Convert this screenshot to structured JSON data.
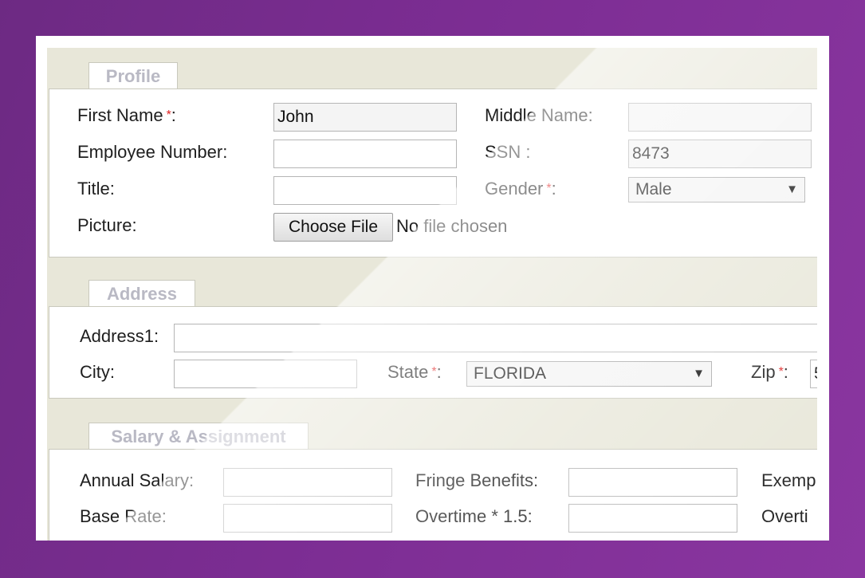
{
  "profile": {
    "tab": "Profile",
    "first_name_label": "First Name",
    "first_name_value": "John",
    "middle_name_label": "Middle Name:",
    "middle_name_value": "",
    "employee_number_label": "Employee Number:",
    "employee_number_value": "",
    "ssn_label": "SSN :",
    "ssn_value": "8473",
    "title_label": "Title:",
    "title_value": "",
    "gender_label": "Gender",
    "gender_value": "Male",
    "picture_label": "Picture:",
    "choose_file": "Choose File",
    "no_file": "No file chosen",
    "required_mark": "*",
    "colon": ":"
  },
  "address": {
    "tab": "Address",
    "address1_label": "Address1:",
    "address1_value": "",
    "city_label": "City:",
    "city_value": "",
    "state_label": "State",
    "state_value": "FLORIDA",
    "zip_label": "Zip",
    "zip_value": "5"
  },
  "salary": {
    "tab": "Salary & Assignment",
    "annual_salary_label": "Annual Salary:",
    "fringe_label": "Fringe Benefits:",
    "exempt_label": "Exemp",
    "base_rate_label": "Base Rate:",
    "overtime_label": "Overtime * 1.5:",
    "overtime2_label": "Overti"
  },
  "icons": {
    "dropdown": "▼"
  },
  "colors": {
    "background": "#6e2a84",
    "panel": "#e8e7d9",
    "required": "#e02020",
    "tab_text": "#b9b9c4"
  }
}
